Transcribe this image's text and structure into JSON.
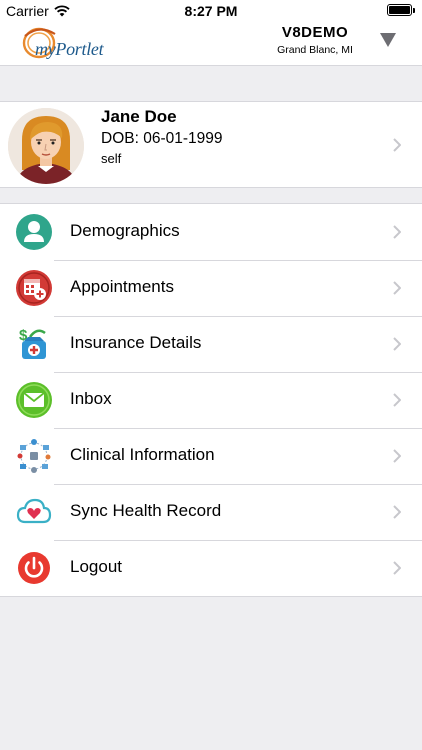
{
  "status_bar": {
    "carrier": "Carrier",
    "time": "8:27 PM",
    "battery_level": 1.0
  },
  "header": {
    "logo_text": "myPortlet",
    "account_name": "V8DEMO",
    "account_location": "Grand Blanc, MI"
  },
  "profile": {
    "name": "Jane Doe",
    "dob": "DOB: 06-01-1999",
    "relation": "self"
  },
  "menu": {
    "items": [
      {
        "label": "Demographics",
        "icon": "person-icon"
      },
      {
        "label": "Appointments",
        "icon": "calendar-add-icon"
      },
      {
        "label": "Insurance Details",
        "icon": "insurance-kit-icon"
      },
      {
        "label": "Inbox",
        "icon": "envelope-icon"
      },
      {
        "label": "Clinical Information",
        "icon": "clinical-network-icon"
      },
      {
        "label": "Sync Health Record",
        "icon": "cloud-heart-icon"
      },
      {
        "label": "Logout",
        "icon": "power-icon"
      }
    ]
  },
  "colors": {
    "background": "#eeeef1",
    "logo_blue": "#1e5a8c",
    "logo_orange": "#e88a2e",
    "teal": "#2fa58b",
    "red": "#d23a36",
    "green": "#5cbf2a",
    "chevron": "#c7c7cc"
  }
}
